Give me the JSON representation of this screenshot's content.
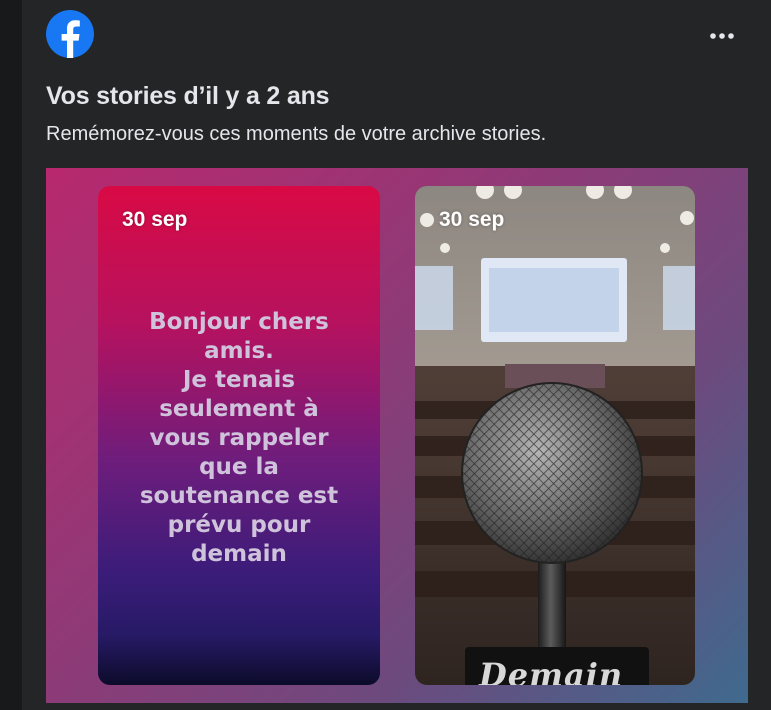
{
  "header": {
    "logo_icon": "facebook-logo-icon",
    "more_icon": "more-options-icon",
    "brand_color": "#1877f2"
  },
  "memory": {
    "title": "Vos stories d’il y a 2 ans",
    "subtitle": "Remémorez-vous ces moments de votre archive stories."
  },
  "stories": [
    {
      "date": "30 sep",
      "text": "Bonjour chers\namis.\nJe tenais\nseulement à\nvous rappeler\nque la\nsoutenance est\nprévu pour\ndemain"
    },
    {
      "date": "30 sep",
      "caption": "Demain"
    }
  ]
}
